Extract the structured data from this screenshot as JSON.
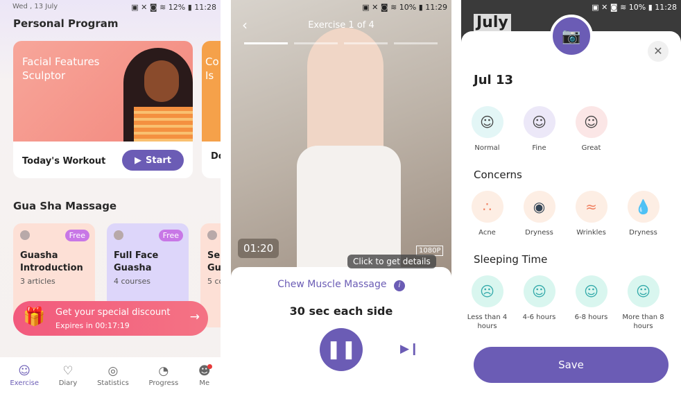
{
  "screen1": {
    "status": {
      "date": "Wed , 13 July",
      "battery": "12%",
      "time": "11:28"
    },
    "personal_program_title": "Personal Program",
    "program_card": {
      "title": "Facial Features Sculptor",
      "footer": "Today's Workout",
      "start_label": "Start"
    },
    "next_card": {
      "title_fragment": "Co Is",
      "footer_fragment": "Do"
    },
    "gua_sha_title": "Gua Sha Massage",
    "gua_sha_cards": [
      {
        "title": "Guasha Introduction",
        "subtitle": "3 articles",
        "badge": "Free",
        "icon": "article-icon"
      },
      {
        "title": "Full Face Guasha",
        "subtitle": "4 courses",
        "badge": "Free",
        "icon": "play-icon"
      },
      {
        "title": "Sep Gu",
        "subtitle": "5 co",
        "icon": "play-icon"
      }
    ],
    "promo": {
      "title": "Get your special discount",
      "subtitle": "Expires in 00:17:19"
    },
    "nav": [
      {
        "label": "Exercise",
        "icon": "face-icon",
        "active": true
      },
      {
        "label": "Diary",
        "icon": "diary-icon"
      },
      {
        "label": "Statistics",
        "icon": "statistics-icon"
      },
      {
        "label": "Progress",
        "icon": "progress-icon"
      },
      {
        "label": "Me",
        "icon": "user-icon",
        "badge": true
      }
    ]
  },
  "screen2": {
    "status": {
      "battery": "10%",
      "time": "11:29"
    },
    "header": "Exercise 1 of 4",
    "progress": {
      "current": 1,
      "total": 4
    },
    "timer": "01:20",
    "quality": "1080P",
    "tooltip": "Click to get details",
    "exercise_name": "Chew Muscle Massage",
    "duration": "30 sec each side"
  },
  "screen3": {
    "status": {
      "battery": "10%",
      "time": "11:28"
    },
    "background_month": "July",
    "date": "Jul 13",
    "skin_options": [
      {
        "label": "Normal",
        "color": "#e3f6f6"
      },
      {
        "label": "Fine",
        "color": "#ece8f8"
      },
      {
        "label": "Great",
        "color": "#fbe6e6"
      }
    ],
    "concerns_title": "Concerns",
    "concerns": [
      {
        "label": "Acne",
        "icon": "acne-icon"
      },
      {
        "label": "Dryness",
        "icon": "eye-icon"
      },
      {
        "label": "Wrinkles",
        "icon": "wrinkles-icon"
      },
      {
        "label": "Dryness",
        "icon": "drop-icon"
      }
    ],
    "sleeping_title": "Sleeping Time",
    "sleep_options": [
      {
        "label": "Less than 4 hours",
        "icon": "sad-face-icon"
      },
      {
        "label": "4-6 hours",
        "icon": "sleepy-face-icon"
      },
      {
        "label": "6-8 hours",
        "icon": "neutral-face-icon"
      },
      {
        "label": "More than 8 hours",
        "icon": "content-face-icon"
      }
    ],
    "save_label": "Save"
  },
  "colors": {
    "accent": "#6b5cb5",
    "promo": "#f25a7d",
    "sleep": "#7fe0c8",
    "concern_bg": "#fdeee4"
  }
}
